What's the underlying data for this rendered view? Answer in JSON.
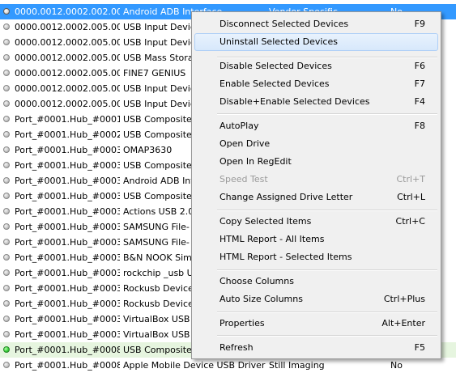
{
  "rows": [
    {
      "c1": "0000.0012.0002.002.00...",
      "c2": "Android ADB Interface",
      "c3": "Vendor Specific",
      "c4": "No"
    },
    {
      "c1": "0000.0012.0002.005.00...",
      "c2": "USB Input Device",
      "c3": "",
      "c4": ""
    },
    {
      "c1": "0000.0012.0002.005.00...",
      "c2": "USB Input Device",
      "c3": "",
      "c4": ""
    },
    {
      "c1": "0000.0012.0002.005.00...",
      "c2": "USB Mass Storage",
      "c3": "",
      "c4": ""
    },
    {
      "c1": "0000.0012.0002.005.00...",
      "c2": "FINE7 GENIUS",
      "c3": "",
      "c4": ""
    },
    {
      "c1": "0000.0012.0002.005.00...",
      "c2": "USB Input Device",
      "c3": "",
      "c4": ""
    },
    {
      "c1": "0000.0012.0002.005.00...",
      "c2": "USB Input Device",
      "c3": "",
      "c4": ""
    },
    {
      "c1": "Port_#0001.Hub_#0001",
      "c2": "USB Composite",
      "c3": "",
      "c4": ""
    },
    {
      "c1": "Port_#0001.Hub_#0002",
      "c2": "USB Composite",
      "c3": "",
      "c4": ""
    },
    {
      "c1": "Port_#0001.Hub_#0003",
      "c2": "OMAP3630",
      "c3": "",
      "c4": ""
    },
    {
      "c1": "Port_#0001.Hub_#0003",
      "c2": "USB Composite",
      "c3": "",
      "c4": ""
    },
    {
      "c1": "Port_#0001.Hub_#0003",
      "c2": "Android ADB Interface",
      "c3": "",
      "c4": ""
    },
    {
      "c1": "Port_#0001.Hub_#0003",
      "c2": "USB Composite",
      "c3": "",
      "c4": ""
    },
    {
      "c1": "Port_#0001.Hub_#0003",
      "c2": "Actions USB 2.0",
      "c3": "",
      "c4": ""
    },
    {
      "c1": "Port_#0001.Hub_#0003",
      "c2": "SAMSUNG File-",
      "c3": "",
      "c4": ""
    },
    {
      "c1": "Port_#0001.Hub_#0003",
      "c2": "SAMSUNG File-",
      "c3": "",
      "c4": ""
    },
    {
      "c1": "Port_#0001.Hub_#0003",
      "c2": "B&N NOOK Sim",
      "c3": "",
      "c4": ""
    },
    {
      "c1": "Port_#0001.Hub_#0003",
      "c2": "rockchip _usb U",
      "c3": "",
      "c4": ""
    },
    {
      "c1": "Port_#0001.Hub_#0003",
      "c2": "Rockusb Device",
      "c3": "",
      "c4": ""
    },
    {
      "c1": "Port_#0001.Hub_#0003",
      "c2": "Rockusb Device",
      "c3": "",
      "c4": ""
    },
    {
      "c1": "Port_#0001.Hub_#0003",
      "c2": "VirtualBox USB",
      "c3": "",
      "c4": ""
    },
    {
      "c1": "Port_#0001.Hub_#0003",
      "c2": "VirtualBox USB",
      "c3": "",
      "c4": ""
    },
    {
      "c1": "Port_#0001.Hub_#0008",
      "c2": "USB Composite",
      "c3": "",
      "c4": ""
    },
    {
      "c1": "Port_#0001.Hub_#0008",
      "c2": "Apple Mobile Device USB Driver",
      "c3": "Still Imaging",
      "c4": "No"
    }
  ],
  "menu": {
    "disconnect": {
      "label": "Disconnect Selected Devices",
      "key": "F9"
    },
    "uninstall": {
      "label": "Uninstall Selected Devices",
      "key": ""
    },
    "disable": {
      "label": "Disable Selected Devices",
      "key": "F6"
    },
    "enable": {
      "label": "Enable Selected Devices",
      "key": "F7"
    },
    "disable_enable": {
      "label": "Disable+Enable Selected Devices",
      "key": "F4"
    },
    "autoplay": {
      "label": "AutoPlay",
      "key": "F8"
    },
    "open_drive": {
      "label": "Open Drive",
      "key": ""
    },
    "open_regedit": {
      "label": "Open In RegEdit",
      "key": ""
    },
    "speed_test": {
      "label": "Speed Test",
      "key": "Ctrl+T"
    },
    "change_letter": {
      "label": "Change Assigned Drive Letter",
      "key": "Ctrl+L"
    },
    "copy_items": {
      "label": "Copy Selected Items",
      "key": "Ctrl+C"
    },
    "html_all": {
      "label": "HTML Report - All Items",
      "key": ""
    },
    "html_selected": {
      "label": "HTML Report - Selected Items",
      "key": ""
    },
    "choose_columns": {
      "label": "Choose Columns",
      "key": ""
    },
    "auto_size": {
      "label": "Auto Size Columns",
      "key": "Ctrl+Plus"
    },
    "properties": {
      "label": "Properties",
      "key": "Alt+Enter"
    },
    "refresh": {
      "label": "Refresh",
      "key": "F5"
    }
  },
  "colors": {
    "selection": "#3399ff",
    "connected_row": "#e6f5df",
    "connected_dot": "#3ad33a",
    "menu_bg": "#f0f0f0"
  }
}
